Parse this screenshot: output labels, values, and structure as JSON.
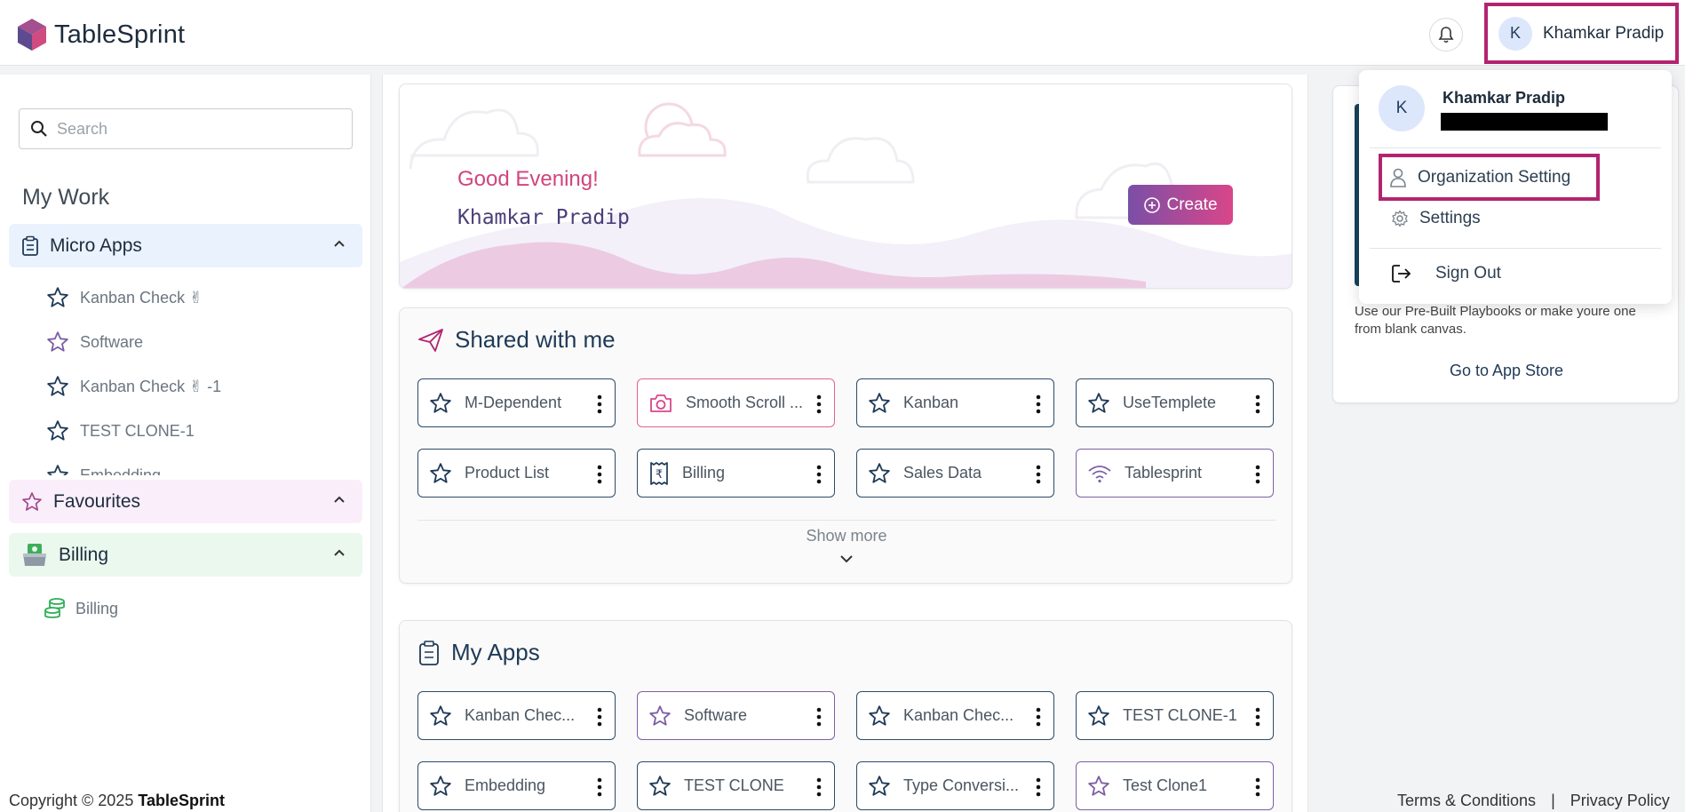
{
  "app": {
    "name": "TableSprint",
    "brand_color": "#b3246f",
    "accent_gradient": [
      "#7a4fa6",
      "#d9468a"
    ]
  },
  "header": {
    "bell_icon": "bell-icon",
    "user": {
      "initial": "K",
      "name": "Khamkar Pradip"
    }
  },
  "sidebar": {
    "search_placeholder": "Search",
    "section_title": "My Work",
    "micro_apps": {
      "label": "Micro Apps",
      "items": [
        {
          "label": "Kanban Check ✌",
          "icon": "star-icon"
        },
        {
          "label": "Software",
          "icon": "star-icon"
        },
        {
          "label": "Kanban Check ✌ -1",
          "icon": "star-icon"
        },
        {
          "label": "TEST CLONE-1",
          "icon": "star-icon"
        },
        {
          "label": "Embedding",
          "icon": "star-icon"
        }
      ]
    },
    "favourites": {
      "label": "Favourites"
    },
    "billing": {
      "label": "Billing",
      "items": [
        {
          "label": "Billing",
          "icon": "database-icon"
        }
      ]
    }
  },
  "hero": {
    "greeting": "Good Evening!",
    "name": "Khamkar Pradip",
    "create_label": "Create"
  },
  "shared": {
    "title": "Shared with me",
    "tiles": [
      {
        "label": "M-Dependent",
        "icon": "star-icon"
      },
      {
        "label": "Smooth Scroll ...",
        "icon": "camera-icon"
      },
      {
        "label": "Kanban",
        "icon": "star-icon"
      },
      {
        "label": "UseTemplete",
        "icon": "star-icon"
      },
      {
        "label": "Product List",
        "icon": "star-icon"
      },
      {
        "label": "Billing",
        "icon": "receipt-icon"
      },
      {
        "label": "Sales Data",
        "icon": "star-icon"
      },
      {
        "label": "Tablesprint",
        "icon": "wifi-icon"
      }
    ],
    "show_more": "Show more"
  },
  "my_apps": {
    "title": "My Apps",
    "tiles": [
      {
        "label": "Kanban Chec...",
        "icon": "star-icon"
      },
      {
        "label": "Software",
        "icon": "star-icon"
      },
      {
        "label": "Kanban Chec...",
        "icon": "star-icon"
      },
      {
        "label": "TEST CLONE-1",
        "icon": "star-icon"
      },
      {
        "label": "Embedding",
        "icon": "star-icon"
      },
      {
        "label": "TEST CLONE",
        "icon": "star-icon"
      },
      {
        "label": "Type Conversi...",
        "icon": "star-icon"
      },
      {
        "label": "Test Clone1",
        "icon": "star-icon"
      }
    ]
  },
  "app_store": {
    "description": "Use our Pre-Built Playbooks or make youre one from blank canvas.",
    "link": "Go to App Store"
  },
  "user_menu": {
    "initial": "K",
    "name": "Khamkar Pradip",
    "items": [
      {
        "label": "Organization Setting",
        "icon": "person-icon"
      },
      {
        "label": "Settings",
        "icon": "gear-icon"
      },
      {
        "label": "Sign Out",
        "icon": "sign-out-icon"
      }
    ]
  },
  "footer": {
    "copyright": "Copyright © 2025",
    "brand": "TableSprint",
    "terms": "Terms & Conditions",
    "separator": "|",
    "privacy": "Privacy Policy"
  }
}
